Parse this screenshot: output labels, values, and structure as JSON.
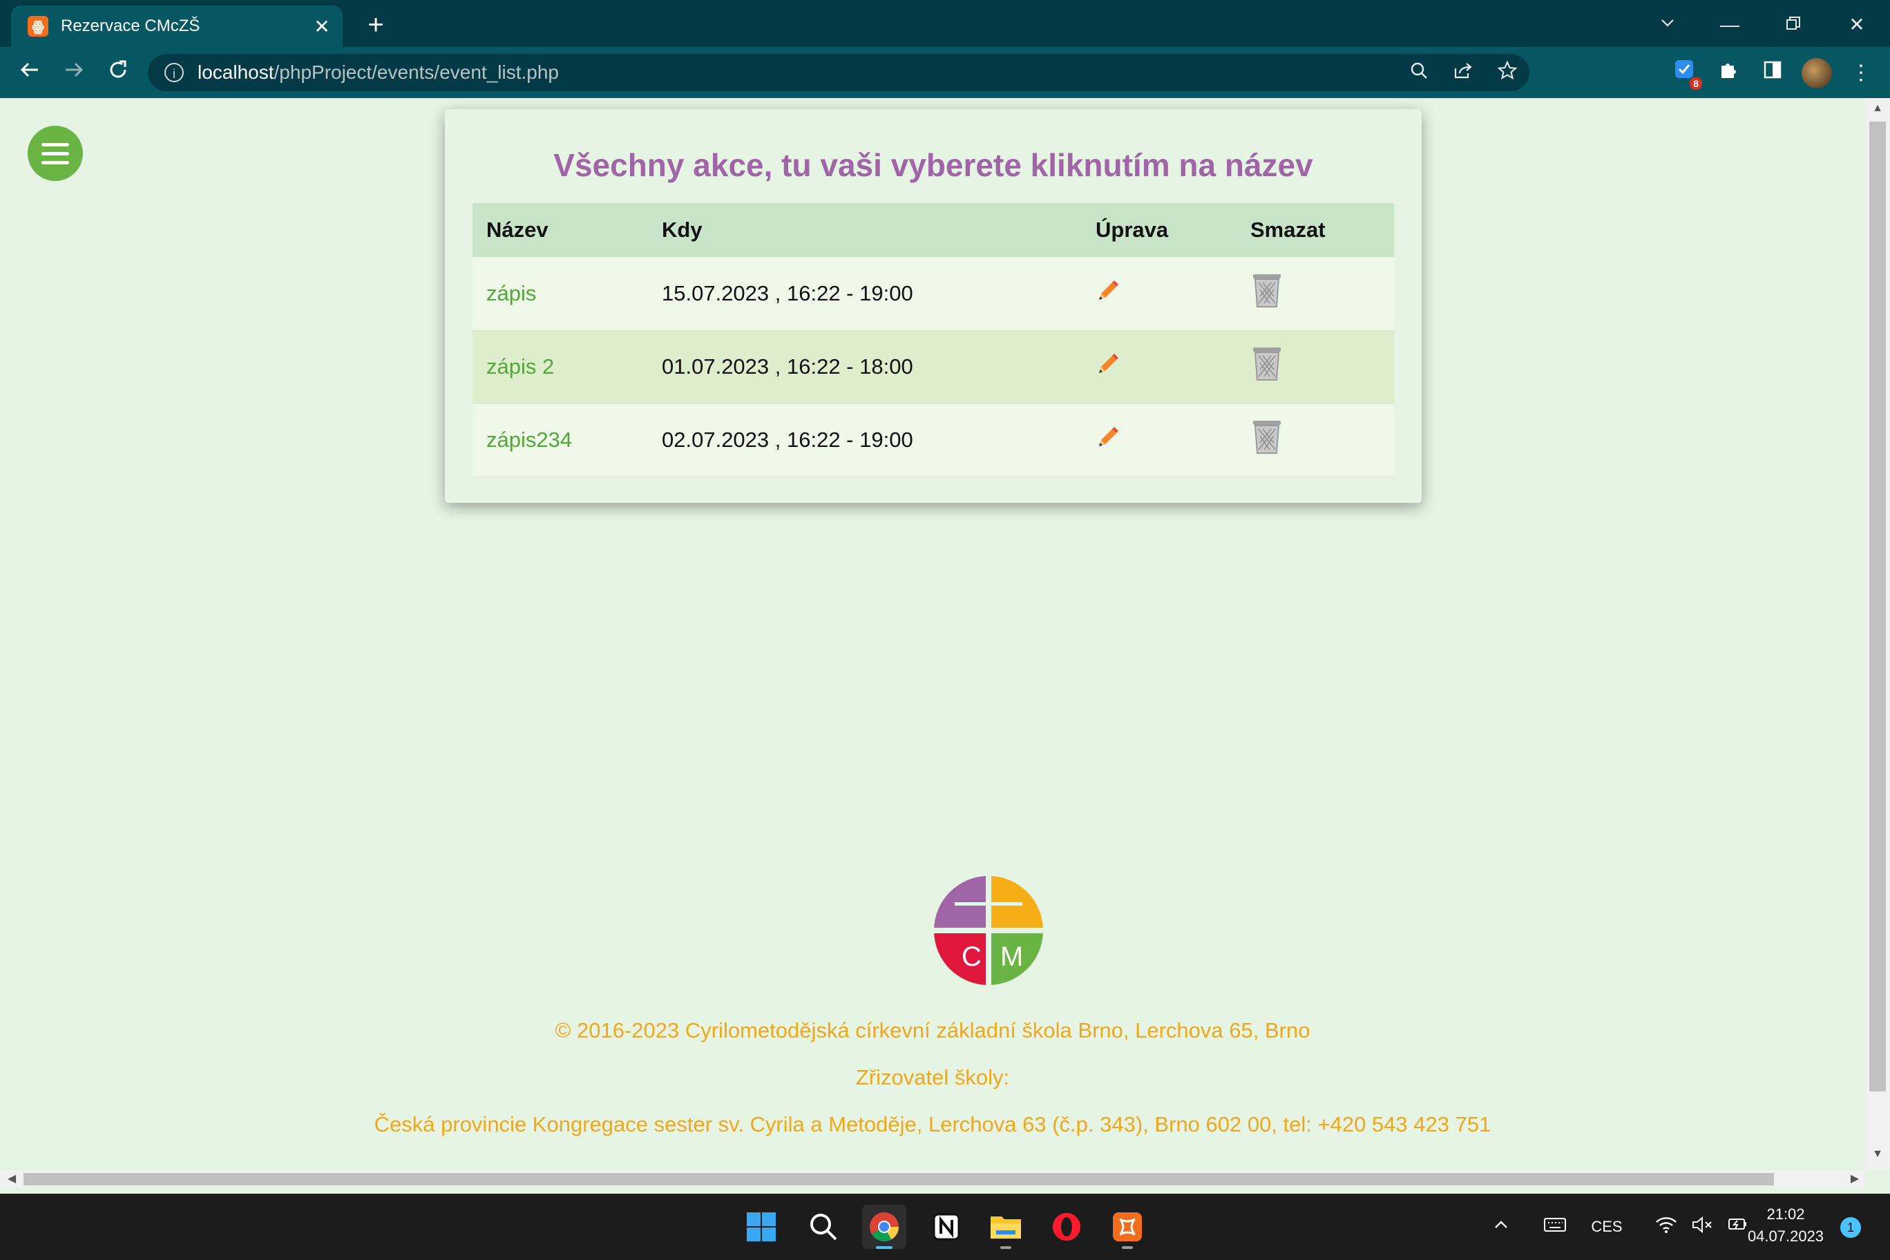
{
  "browser": {
    "tab_title": "Rezervace CMcZŠ",
    "tab_favicon_glyph": "ꙮ",
    "url_host": "localhost",
    "url_path": "/phpProject/events/event_list.php",
    "extension_badge": "8"
  },
  "page": {
    "title": "Všechny akce, tu vaši vyberete kliknutím na název",
    "columns": [
      "Název",
      "Kdy",
      "Úprava",
      "Smazat"
    ],
    "events": [
      {
        "name": "zápis",
        "when": "15.07.2023 , 16:22 - 19:00"
      },
      {
        "name": "zápis 2",
        "when": "01.07.2023 , 16:22 - 18:00"
      },
      {
        "name": "zápis234",
        "when": "02.07.2023 , 16:22 - 19:00"
      }
    ],
    "logo_letters": {
      "left": "C",
      "right": "M"
    },
    "footer": {
      "copyright": "© 2016-2023 Cyrilometodějská církevní základní škola Brno, Lerchova 65, Brno",
      "founder_label": "Zřizovatel školy:",
      "founder": "Česká provincie Kongregace sester sv. Cyrila a Metoděje, Lerchova 63 (č.p. 343), Brno 602 00, tel: +420 543 423 751"
    }
  },
  "taskbar": {
    "language": "CES",
    "time": "21:02",
    "date": "04.07.2023",
    "notifications": "1"
  },
  "colors": {
    "chrome_dark": "#033a46",
    "chrome_tab": "#075763",
    "page_bg": "#e6f4e4",
    "title_purple": "#a065a7",
    "link_green": "#55a63a",
    "footer_orange": "#f2a71b",
    "menu_green": "#6ab443"
  }
}
